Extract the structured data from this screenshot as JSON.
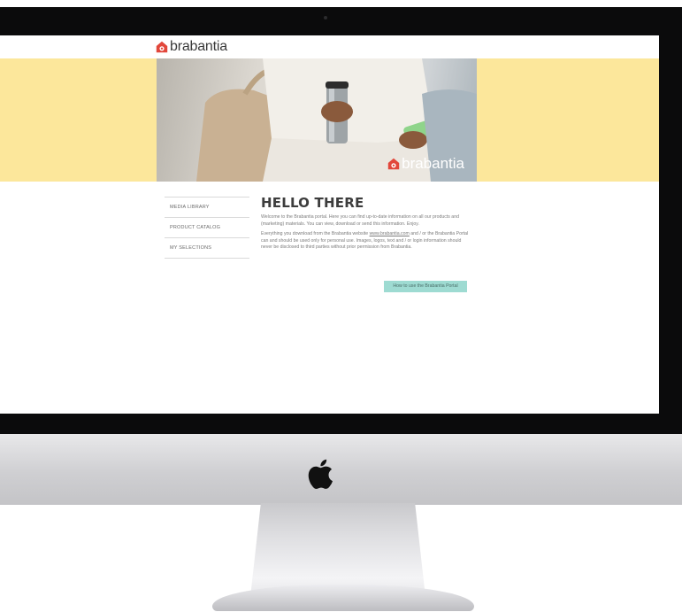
{
  "site": {
    "brand": "brabantia",
    "hero_brand": "brabantia"
  },
  "sidebar": {
    "items": [
      {
        "label": "MEDIA LIBRARY"
      },
      {
        "label": "PRODUCT CATALOG"
      },
      {
        "label": "MY SELECTIONS"
      }
    ]
  },
  "main": {
    "title": "HELLO THERE",
    "intro": "Welcome to the Brabantia portal. Here you can find up-to-date information on all our products and (marketing) materials. You can view, download or send this information. Enjoy.",
    "notice_before": "Everything you download from the Brabantia website ",
    "notice_link": "www.brabantia.com",
    "notice_after": " and / or the Brabantia Portal can and should be used only for personal use. Images, logos, text and / or login information should never be disclosed to third parties without prior permission from Brabantia.",
    "cta_label": "How to use the Brabantia Portal"
  },
  "colors": {
    "hero_band": "#fce79b",
    "brand_red": "#e2473b",
    "cta": "#9edbd2"
  },
  "icons": [
    "brabantia-logo-icon",
    "apple-logo-icon"
  ]
}
